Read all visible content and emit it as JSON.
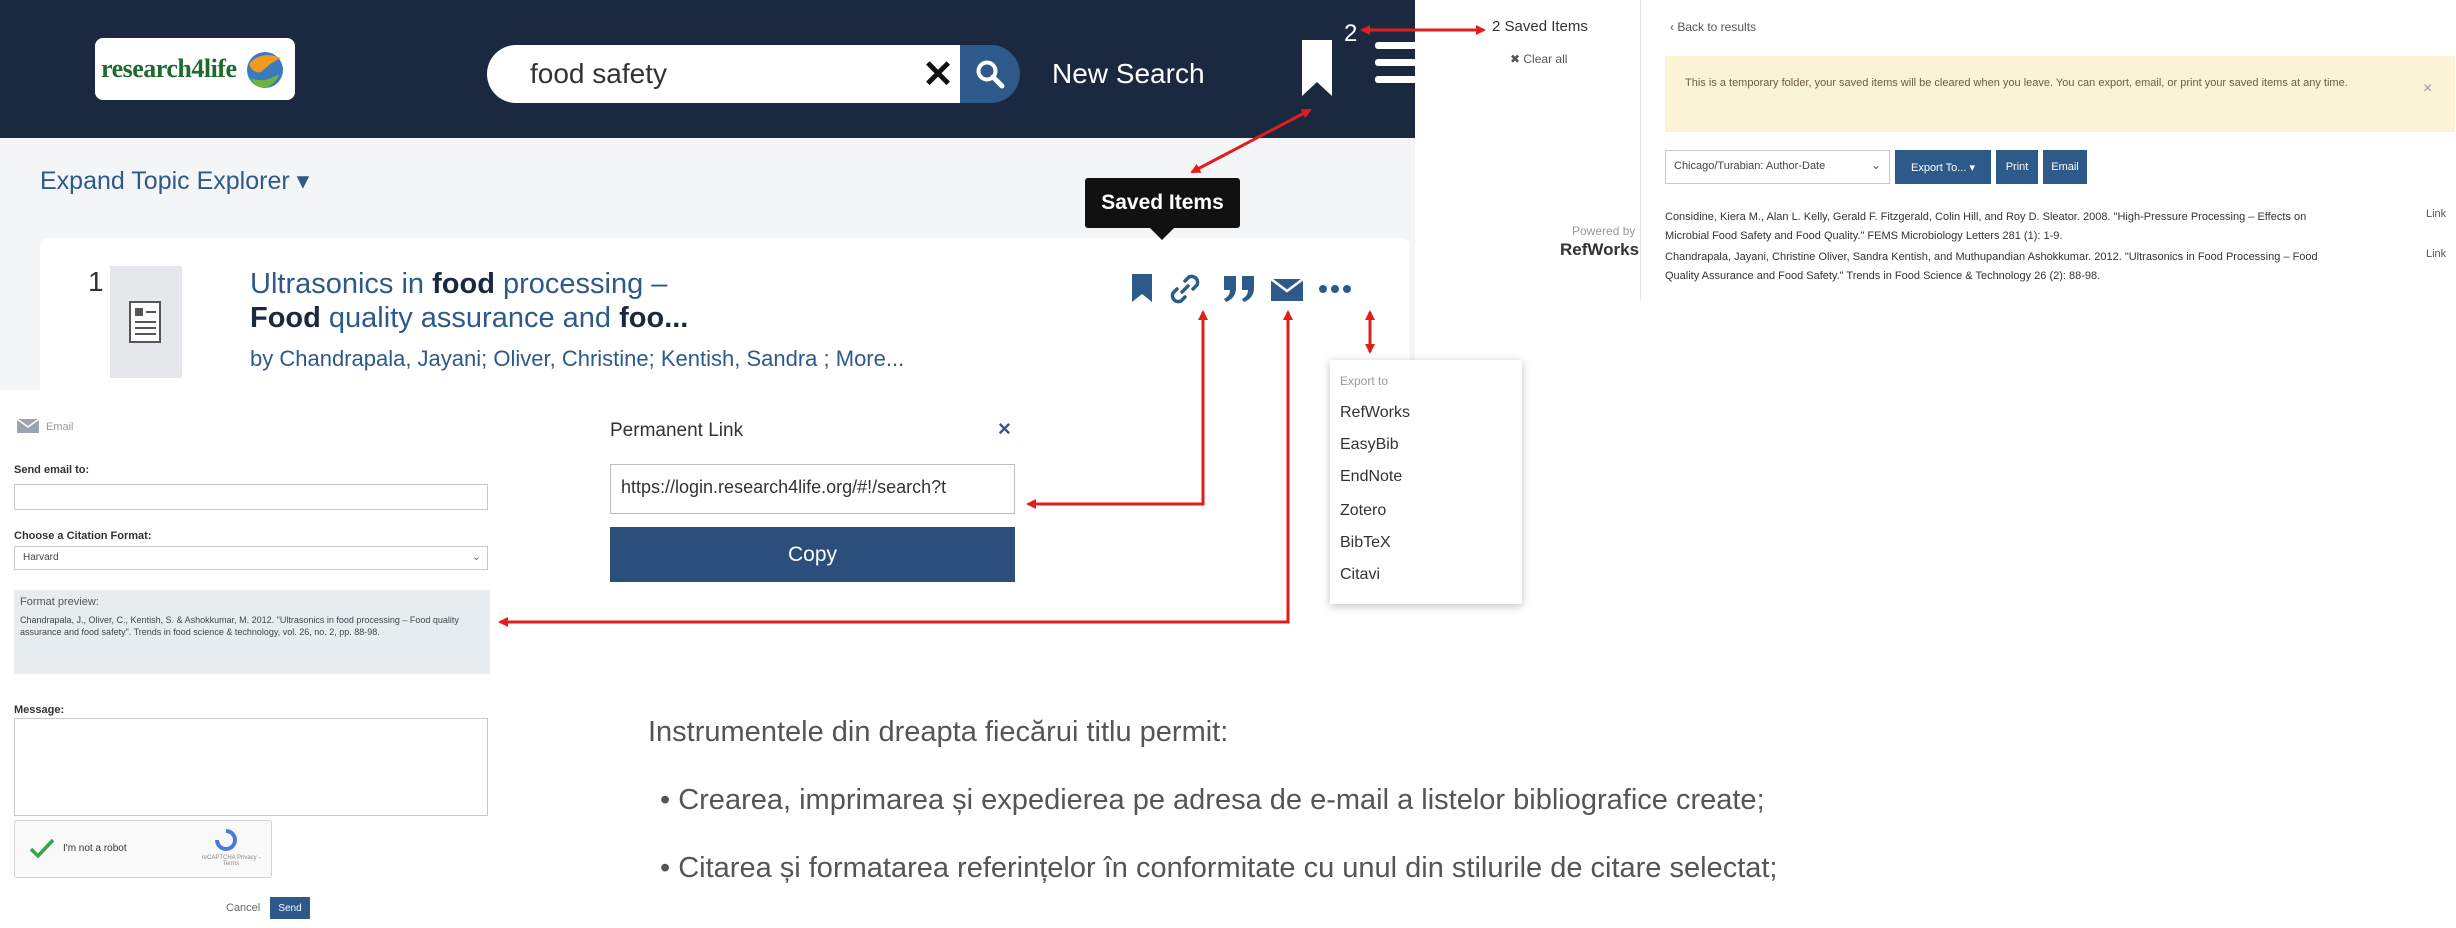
{
  "results": {
    "logo_text": "research4life",
    "search_value": "food safety",
    "new_search_label": "New Search",
    "saved_count": "2",
    "expand_topic_label": "Expand Topic Explorer ▾",
    "tooltip_label": "Saved Items",
    "result": {
      "number": "1",
      "title_line1_pre": "Ultrasonics in ",
      "title_line1_kw": "food",
      "title_line1_post": " processing –",
      "title_line2_kw1": "Food",
      "title_line2_mid": " quality assurance and ",
      "title_line2_kw2": "foo...",
      "authors": "by Chandrapala, Jayani; Oliver, Christine; Kentish, Sandra ; More..."
    }
  },
  "email_form": {
    "header": "Email",
    "send_to_label": "Send email to:",
    "citation_format_label": "Choose a Citation Format:",
    "citation_format_value": "Harvard",
    "format_preview_label": "Format preview:",
    "format_preview_text": "Chandrapala, J., Oliver, C., Kentish, S. & Ashokkumar, M. 2012. \"Ultrasonics in food processing – Food quality assurance and food safety\". Trends in food science & technology, vol. 26, no. 2, pp. 88-98.",
    "message_label": "Message:",
    "captcha_label": "I'm not a robot",
    "captcha_small": "reCAPTCHA Privacy - Terms",
    "cancel_label": "Cancel",
    "send_label": "Send"
  },
  "permalink": {
    "title": "Permanent Link",
    "close": "×",
    "url": "https://login.research4life.org/#!/search?t",
    "copy_label": "Copy"
  },
  "export_menu": {
    "title": "Export to",
    "items": [
      "RefWorks",
      "EasyBib",
      "EndNote",
      "Zotero",
      "BibTeX",
      "Citavi"
    ]
  },
  "saved_panel": {
    "saved_items": "2 Saved Items",
    "clear_all": "✖ Clear all",
    "powered_by": "Powered by",
    "refworks": "RefWorks",
    "back_to_results": "‹ Back to results",
    "notice": "This is a temporary folder, your saved items will be cleared when you leave. You can export, email, or print your saved items at any time.",
    "notice_close": "×",
    "style_value": "Chicago/Turabian: Author-Date",
    "export_to_label": "Export To... ▾",
    "print_label": "Print",
    "email_label": "Email",
    "citations": [
      "Considine, Kiera M., Alan L. Kelly, Gerald F. Fitzgerald, Colin Hill, and Roy D. Sleator. 2008. \"High-Pressure Processing – Effects on Microbial Food Safety and Food Quality.\" FEMS Microbiology Letters 281 (1): 1-9.",
      "Chandrapala, Jayani, Christine Oliver, Sandra Kentish, and Muthupandian Ashokkumar. 2012. \"Ultrasonics in Food Processing – Food Quality Assurance and Food Safety.\" Trends in Food Science & Technology 26 (2): 88-98."
    ],
    "link_label": "Link"
  },
  "description": {
    "intro": "Instrumentele din dreapta fiecărui titlu permit:",
    "bullets": [
      "• Crearea, imprimarea și expedierea pe adresa de e-mail a listelor bibliografice create;",
      "• Citarea și formatarea referințelor în conformitate cu unul din stilurile de citare selectat;"
    ]
  },
  "colors": {
    "navbar": "#1b2940",
    "accent": "#2d5a8a",
    "arrow": "#e01e1e"
  }
}
